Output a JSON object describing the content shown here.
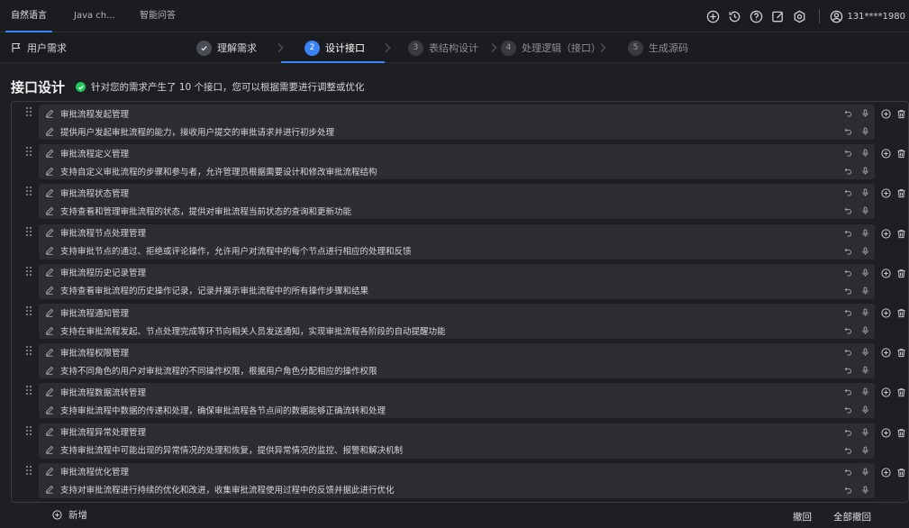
{
  "tabs": [
    {
      "label": "自然语言",
      "active": true
    },
    {
      "label": "Java ch...",
      "active": false
    },
    {
      "label": "智能问答",
      "active": false
    }
  ],
  "top_icons": [
    "plus-circle-icon",
    "history-icon",
    "help-icon",
    "edit-icon",
    "settings-icon"
  ],
  "user": {
    "name": "131****1980"
  },
  "stepbar": {
    "requirement_label": "用户需求",
    "steps": [
      {
        "num": "",
        "label": "理解需求",
        "state": "done"
      },
      {
        "num": "2",
        "label": "设计接口",
        "state": "active"
      },
      {
        "num": "3",
        "label": "表结构设计",
        "state": "pending"
      },
      {
        "num": "4",
        "label": "处理逻辑（接口）",
        "state": "pending"
      },
      {
        "num": "5",
        "label": "生成源码",
        "state": "pending"
      }
    ]
  },
  "heading": {
    "title": "接口设计",
    "subtitle": "针对您的需求产生了 10 个接口，您可以根据需要进行调整或优化"
  },
  "interfaces": [
    {
      "name": "审批流程发起管理",
      "desc": "提供用户发起审批流程的能力，接收用户提交的审批请求并进行初步处理"
    },
    {
      "name": "审批流程定义管理",
      "desc": "支持自定义审批流程的步骤和参与者，允许管理员根据需要设计和修改审批流程结构"
    },
    {
      "name": "审批流程状态管理",
      "desc": "支持查看和管理审批流程的状态，提供对审批流程当前状态的查询和更新功能"
    },
    {
      "name": "审批流程节点处理管理",
      "desc": "支持审批节点的通过、拒绝或评论操作，允许用户对流程中的每个节点进行相应的处理和反馈"
    },
    {
      "name": "审批流程历史记录管理",
      "desc": "支持查看审批流程的历史操作记录，记录并展示审批流程中的所有操作步骤和结果"
    },
    {
      "name": "审批流程通知管理",
      "desc": "支持在审批流程发起、节点处理完成等环节向相关人员发送通知，实现审批流程各阶段的自动提醒功能"
    },
    {
      "name": "审批流程权限管理",
      "desc": "支持不同角色的用户对审批流程的不同操作权限，根据用户角色分配相应的操作权限"
    },
    {
      "name": "审批流程数据流转管理",
      "desc": "支持审批流程中数据的传递和处理，确保审批流程各节点间的数据能够正确流转和处理"
    },
    {
      "name": "审批流程异常处理管理",
      "desc": "支持审批流程中可能出现的异常情况的处理和恢复，提供异常情况的监控、报警和解决机制"
    },
    {
      "name": "审批流程优化管理",
      "desc": "支持对审批流程进行持续的优化和改进，收集审批流程使用过程中的反馈并据此进行优化"
    }
  ],
  "footer": {
    "add_label": "新增",
    "undo_label": "撤回",
    "undo_all_label": "全部撤回"
  },
  "colors": {
    "accent": "#3b82f6",
    "success": "#22c55e",
    "background": "#1e1f22",
    "card": "#2c2d31"
  }
}
